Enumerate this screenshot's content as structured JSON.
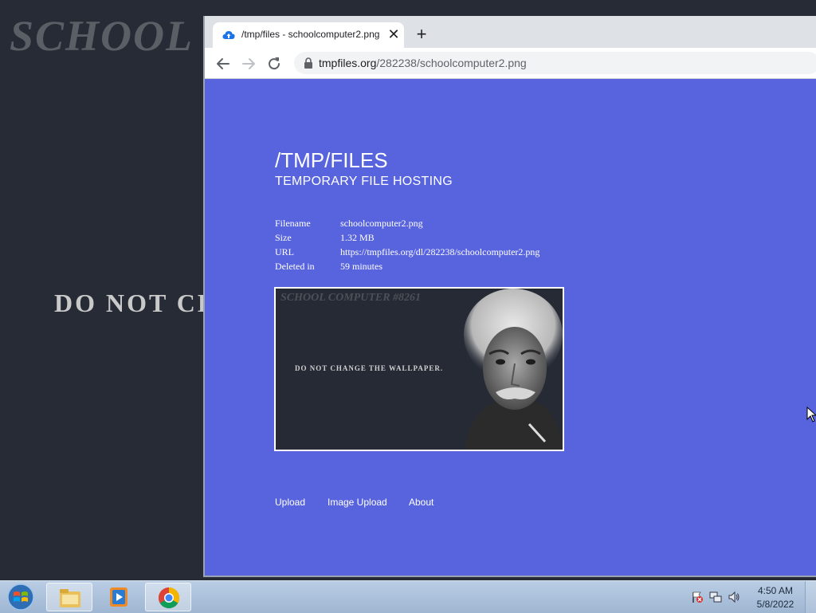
{
  "desktop": {
    "wallpaper_title": "SCHOOL CO",
    "wallpaper_notice": "DO NOT CHA"
  },
  "browser": {
    "tab_title": "/tmp/files - schoolcomputer2.png",
    "url_host": "tmpfiles.org",
    "url_path": "/282238/schoolcomputer2.png",
    "icons": [
      "cloud-upload-icon",
      "close-icon",
      "plus-icon",
      "back-arrow-icon",
      "forward-arrow-icon",
      "reload-icon",
      "lock-icon"
    ]
  },
  "page": {
    "title": "/TMP/FILES",
    "subtitle": "TEMPORARY FILE HOSTING",
    "file_info": [
      {
        "label": "Filename",
        "value": "schoolcomputer2.png"
      },
      {
        "label": "Size",
        "value": "1.32 MB"
      },
      {
        "label": "URL",
        "value": "https://tmpfiles.org/dl/282238/schoolcomputer2.png"
      },
      {
        "label": "Deleted in",
        "value": "59 minutes"
      }
    ],
    "preview": {
      "title": "SCHOOL COMPUTER #8261",
      "notice": "DO NOT CHANGE THE WALLPAPER."
    },
    "footer_links": {
      "upload": "Upload",
      "image_upload": "Image Upload",
      "about": "About"
    },
    "background_color": "#5864de"
  },
  "taskbar": {
    "clock_time": "4:50 AM",
    "clock_date": "5/8/2022",
    "icons": [
      "windows-start-icon",
      "file-explorer-icon",
      "media-player-icon",
      "chrome-icon",
      "action-center-flag-icon",
      "network-icon",
      "volume-icon"
    ]
  }
}
